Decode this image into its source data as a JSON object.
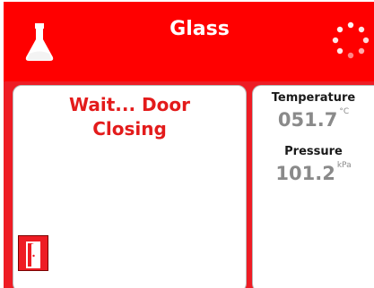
{
  "header": {
    "title": "Glass",
    "left_icon": "flask-icon",
    "right_icon": "loading-spinner-icon"
  },
  "status": {
    "message": "Wait... Door\nClosing",
    "door_button_icon": "door-icon"
  },
  "readings": {
    "temperature_label": "Temperature",
    "temperature_value": "051.7",
    "temperature_unit": "°C",
    "pressure_label": "Pressure",
    "pressure_value": "101.2",
    "pressure_unit": "kPa"
  },
  "colors": {
    "header_red": "#ff0000",
    "status_text_red": "#e31b1b",
    "value_gray": "#8a8a8a"
  }
}
